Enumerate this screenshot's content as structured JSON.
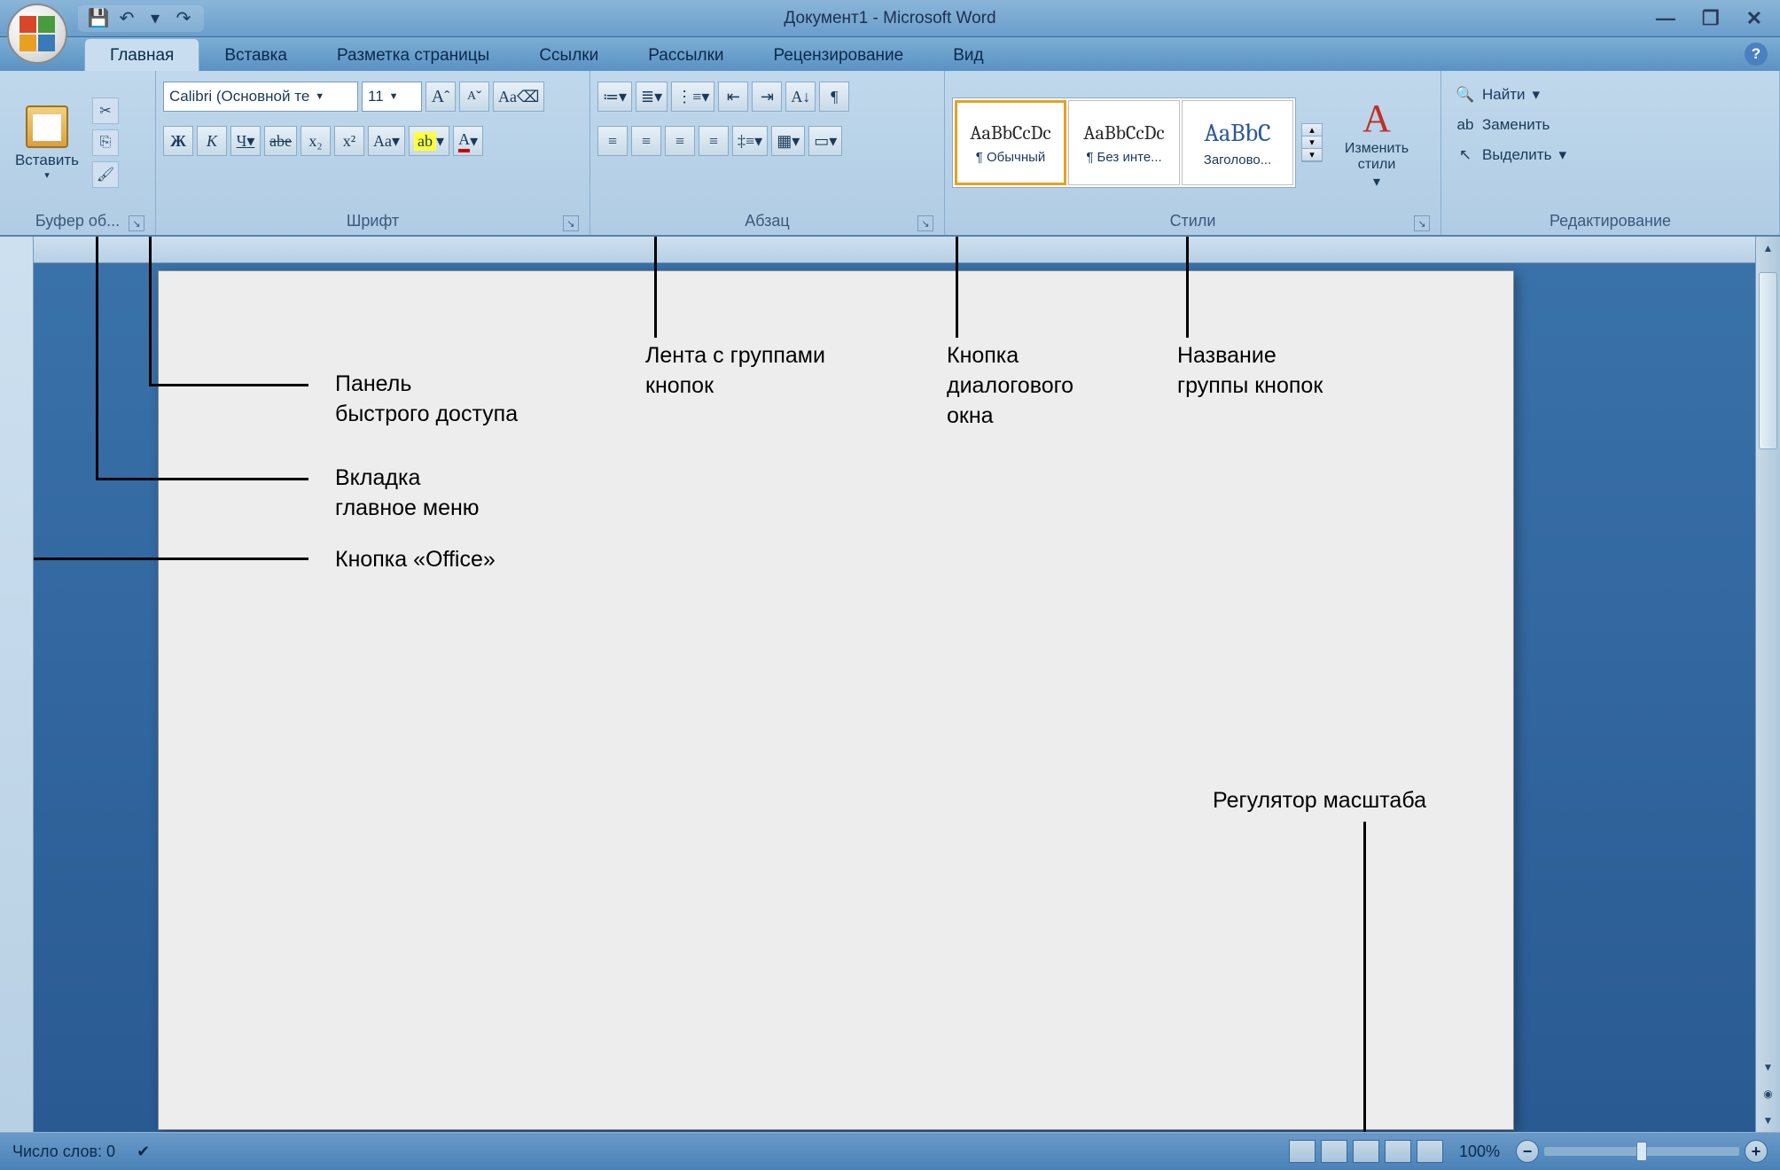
{
  "title": "Документ1 - Microsoft Word",
  "qat": {
    "save": "💾",
    "undo": "↶",
    "redo": "↷"
  },
  "tabs": [
    "Главная",
    "Вставка",
    "Разметка страницы",
    "Ссылки",
    "Рассылки",
    "Рецензирование",
    "Вид"
  ],
  "clipboard": {
    "paste": "Вставить",
    "label": "Буфер об..."
  },
  "font": {
    "name": "Calibri (Основной те",
    "size": "11",
    "label": "Шрифт",
    "bold": "Ж",
    "italic": "К",
    "under": "Ч",
    "strike": "abe",
    "sub": "x₂",
    "sup": "x²",
    "case": "Aa",
    "grow": "A",
    "shrink": "A",
    "clear": "⌫"
  },
  "para": {
    "label": "Абзац"
  },
  "styles": {
    "label": "Стили",
    "items": [
      {
        "prev": "AaBbCcDc",
        "name": "¶ Обычный"
      },
      {
        "prev": "AaBbCcDc",
        "name": "¶ Без инте..."
      },
      {
        "prev": "AaBbC",
        "name": "Заголово..."
      }
    ],
    "change": "Изменить стили"
  },
  "editing": {
    "label": "Редактирование",
    "find": "Найти",
    "replace": "Заменить",
    "select": "Выделить"
  },
  "status": {
    "words": "Число слов: 0",
    "zoom": "100%"
  },
  "anno": {
    "qat": "Панель\nбыстрого доступа",
    "tab": "Вкладка\nглавное меню",
    "office": "Кнопка «Office»",
    "ribbon": "Лента с группами\nкнопок",
    "dlg": "Кнопка\nдиалогового\nокна",
    "groupname": "Название\nгруппы кнопок",
    "zoom": "Регулятор масштаба"
  }
}
